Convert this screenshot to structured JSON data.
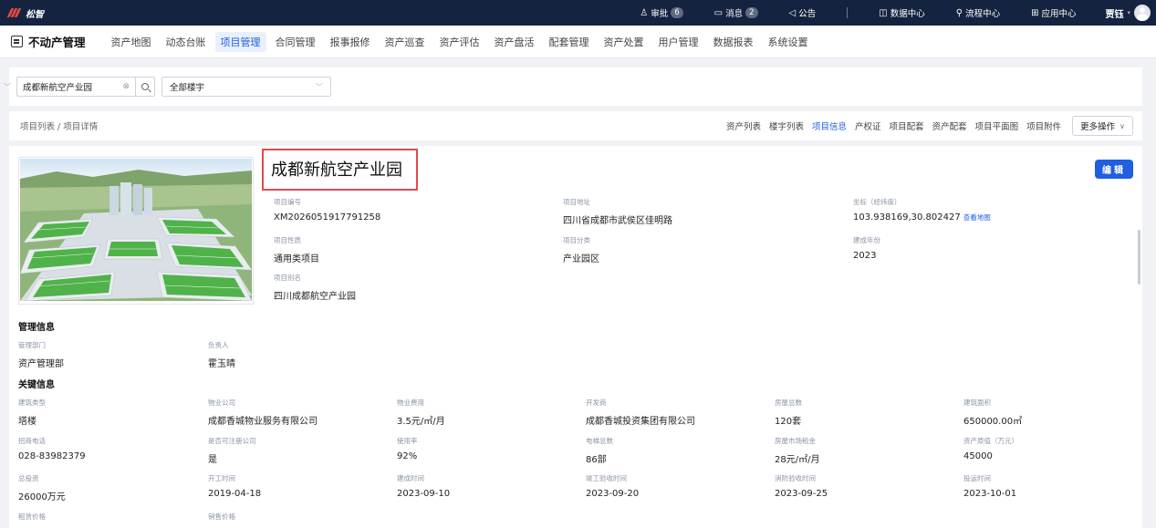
{
  "topbar": {
    "logo_text": "松智",
    "approval_label": "审批",
    "approval_count": "6",
    "message_label": "消息",
    "message_count": "2",
    "notice_label": "公告",
    "data_center_label": "数据中心",
    "flow_center_label": "流程中心",
    "app_center_label": "应用中心",
    "user_name": "贾钰"
  },
  "navbar": {
    "app_title": "不动产管理",
    "items": [
      "资产地图",
      "动态台账",
      "项目管理",
      "合同管理",
      "报事报修",
      "资产巡查",
      "资产评估",
      "资产盘活",
      "配套管理",
      "资产处置",
      "用户管理",
      "数据报表",
      "系统设置"
    ],
    "active": "项目管理"
  },
  "filter": {
    "project_value": "成都新航空产业园",
    "building_select": "全部楼宇"
  },
  "breadcrumb": "项目列表 / 项目详情",
  "tabs": {
    "items": [
      "资产列表",
      "楼宇列表",
      "项目信息",
      "产权证",
      "项目配套",
      "资产配套",
      "项目平面图",
      "项目附件"
    ],
    "active": "项目信息",
    "more_label": "更多操作"
  },
  "project": {
    "title": "成都新航空产业园",
    "edit_label": "编辑",
    "map_link": "查看地图",
    "basic": [
      {
        "label": "项目编号",
        "value": "XM2026051917791258"
      },
      {
        "label": "项目地址",
        "value": "四川省成都市武侯区佳明路"
      },
      {
        "label": "坐标（经纬度）",
        "value": "103.938169,30.802427"
      },
      {
        "label": "项目性质",
        "value": "通用类项目"
      },
      {
        "label": "项目分类",
        "value": "产业园区"
      },
      {
        "label": "建成年份",
        "value": "2023"
      },
      {
        "label": "项目别名",
        "value": "四川成都航空产业园"
      }
    ]
  },
  "management": {
    "title": "管理信息",
    "fields": [
      {
        "label": "管理部门",
        "value": "资产管理部"
      },
      {
        "label": "负责人",
        "value": "霍玉晴"
      }
    ]
  },
  "key_info": {
    "title": "关键信息",
    "fields": [
      {
        "label": "建筑类型",
        "value": "塔楼"
      },
      {
        "label": "物业公司",
        "value": "成都香城物业服务有限公司"
      },
      {
        "label": "物业费用",
        "value": "3.5元/㎡/月"
      },
      {
        "label": "开发商",
        "value": "成都香城投资集团有限公司"
      },
      {
        "label": "房屋总数",
        "value": "120套"
      },
      {
        "label": "建筑面积",
        "value": "650000.00㎡"
      },
      {
        "label": "招商电话",
        "value": "028-83982379"
      },
      {
        "label": "是否可注册公司",
        "value": "是"
      },
      {
        "label": "使用率",
        "value": "92%"
      },
      {
        "label": "电梯总数",
        "value": "86部"
      },
      {
        "label": "房屋市场租金",
        "value": "28元/㎡/月"
      },
      {
        "label": "资产原值（万元）",
        "value": "45000"
      },
      {
        "label": "总投资",
        "value": "26000万元"
      },
      {
        "label": "开工时间",
        "value": "2019-04-18"
      },
      {
        "label": "建成时间",
        "value": "2023-09-10"
      },
      {
        "label": "竣工验收时间",
        "value": "2023-09-20"
      },
      {
        "label": "消防验收时间",
        "value": "2023-09-25"
      },
      {
        "label": "投运时间",
        "value": "2023-10-01"
      },
      {
        "label": "租赁价格",
        "value": ""
      },
      {
        "label": "销售价格",
        "value": ""
      }
    ]
  }
}
